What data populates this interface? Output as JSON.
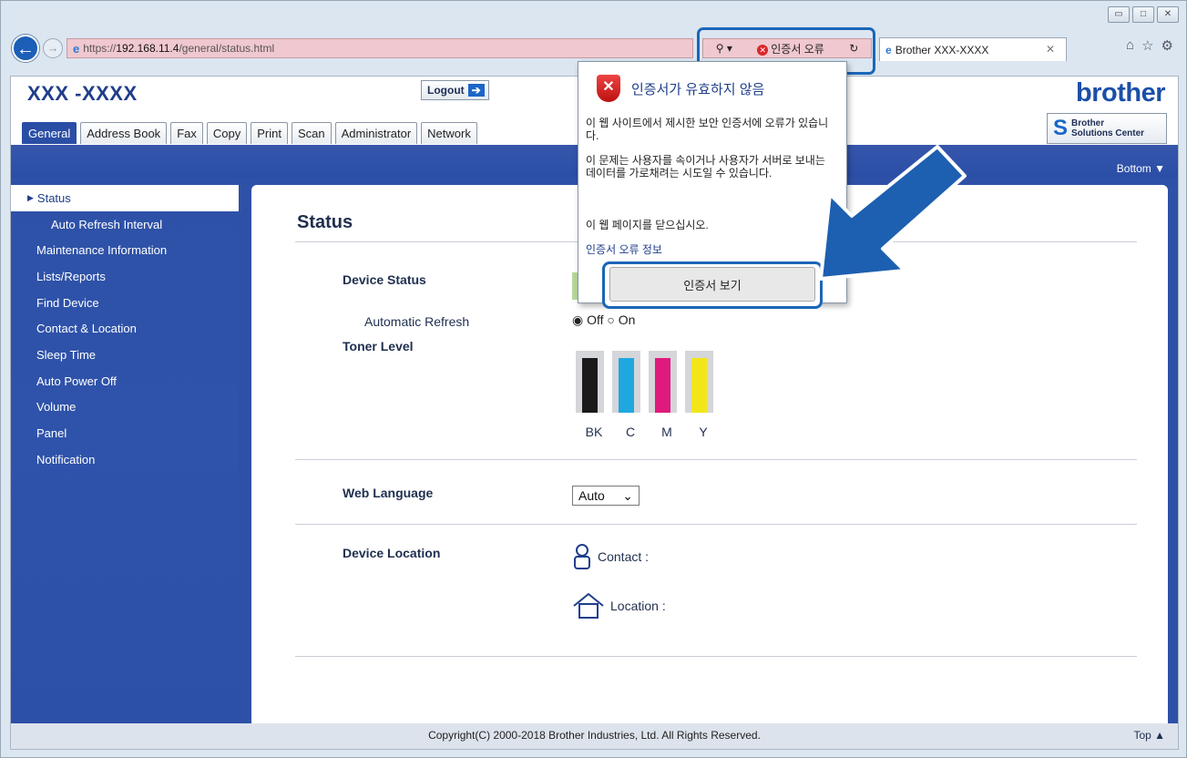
{
  "browser": {
    "url_prefix": "https://",
    "url_host": "192.168.11.4",
    "url_path": "/general/status.html",
    "cert_error_label": "인증서 오류",
    "tab_title": "Brother XXX-XXXX"
  },
  "header": {
    "model": "XXX -XXXX",
    "logout": "Logout",
    "brand": "brother",
    "bsc_line1": "Brother",
    "bsc_line2": "Solutions Center",
    "bottom_link": "Bottom ▼"
  },
  "tabs": [
    {
      "label": "General"
    },
    {
      "label": "Address Book"
    },
    {
      "label": "Fax"
    },
    {
      "label": "Copy"
    },
    {
      "label": "Print"
    },
    {
      "label": "Scan"
    },
    {
      "label": "Administrator"
    },
    {
      "label": "Network"
    }
  ],
  "sidebar": {
    "items": [
      {
        "label": "Status"
      },
      {
        "label": "Auto Refresh Interval"
      },
      {
        "label": "Maintenance Information"
      },
      {
        "label": "Lists/Reports"
      },
      {
        "label": "Find Device"
      },
      {
        "label": "Contact & Location"
      },
      {
        "label": "Sleep Time"
      },
      {
        "label": "Auto Power Off"
      },
      {
        "label": "Volume"
      },
      {
        "label": "Panel"
      },
      {
        "label": "Notification"
      }
    ]
  },
  "main": {
    "title": "Status",
    "device_status": "Device Status",
    "automatic_refresh": "Automatic Refresh",
    "radio_off_label": "Off",
    "radio_on_label": "On",
    "toner_level": "Toner Level",
    "toner_labels": [
      "BK",
      "C",
      "M",
      "Y"
    ],
    "toner_colors": [
      "#1a1a1a",
      "#1fa8e0",
      "#e0197d",
      "#f2e619"
    ],
    "web_language": "Web Language",
    "web_language_value": "Auto",
    "device_location": "Device Location",
    "contact_label": "Contact :",
    "location_label": "Location :"
  },
  "footer": {
    "copyright": "Copyright(C) 2000-2018 Brother Industries, Ltd. All Rights Reserved.",
    "top_link": "Top ▲"
  },
  "popup": {
    "title": "인증서가 유효하지 않음",
    "para1": "이 웹 사이트에서 제시한 보안 인증서에 오류가 있습니다.",
    "para2": "이 문제는 사용자를 속이거나 사용자가 서버로 보내는 데이터를 가로채려는 시도일 수 있습니다.",
    "para3": "이 웹 페이지를 닫으십시오.",
    "link": "인증서 오류 정보",
    "view_button": "인증서 보기"
  }
}
